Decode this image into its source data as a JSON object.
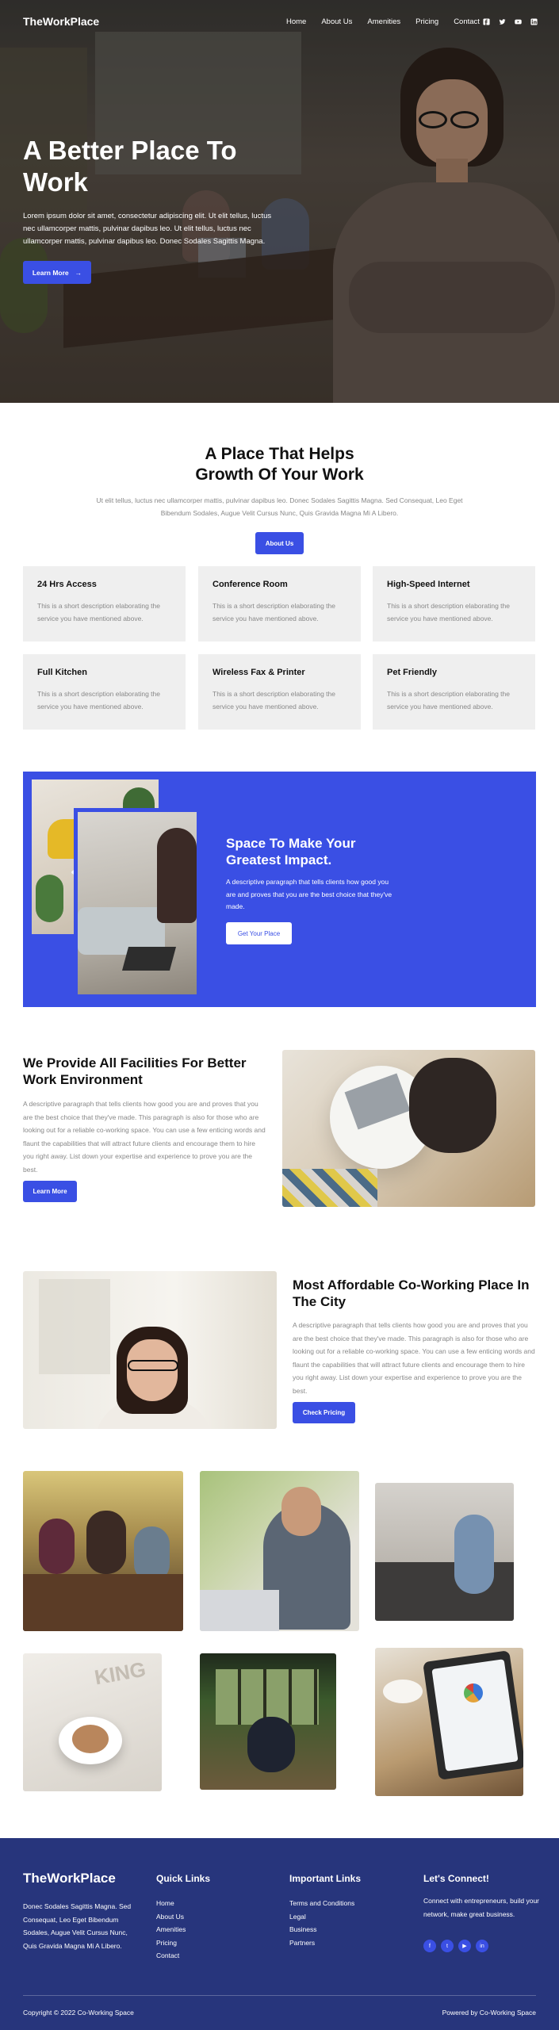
{
  "brand": {
    "logo": "TheWorkPlace",
    "accent": "#3a4fe4",
    "footer_bg": "#27357c"
  },
  "nav": {
    "items": [
      "Home",
      "About Us",
      "Amenities",
      "Pricing",
      "Contact"
    ],
    "socials": [
      "facebook-icon",
      "twitter-icon",
      "youtube-icon",
      "linkedin-icon"
    ]
  },
  "hero": {
    "title": "A Better Place To Work",
    "text": "Lorem ipsum dolor sit amet, consectetur adipiscing elit. Ut elit tellus, luctus nec ullamcorper mattis, pulvinar dapibus leo. Ut elit tellus, luctus nec ullamcorper mattis, pulvinar dapibus leo. Donec Sodales Sagittis Magna.",
    "button": "Learn More",
    "button_arrow": "→"
  },
  "intro": {
    "title": "A Place That Helps Growth Of Your Work",
    "text": "Ut elit tellus, luctus nec ullamcorper mattis, pulvinar dapibus leo. Donec Sodales Sagittis Magna. Sed Consequat, Leo Eget Bibendum Sodales, Augue Velit Cursus Nunc, Quis Gravida Magna Mi A Libero.",
    "button": "About Us"
  },
  "amenities": [
    {
      "title": "24 Hrs Access",
      "text": "This is a short description elaborating the service you have mentioned above."
    },
    {
      "title": "Conference Room",
      "text": "This is a short description elaborating the service you have mentioned above."
    },
    {
      "title": "High-Speed Internet",
      "text": "This is a short description elaborating the service you have mentioned above."
    },
    {
      "title": "Full Kitchen",
      "text": "This is a short description elaborating the service you have mentioned above."
    },
    {
      "title": "Wireless Fax & Printer",
      "text": "This is a short description elaborating the service you have mentioned above."
    },
    {
      "title": "Pet Friendly",
      "text": "This is a short description elaborating the service you have mentioned above."
    }
  ],
  "impact": {
    "title": "Space To Make Your Greatest Impact.",
    "text": "A descriptive paragraph that tells clients how good you are and proves that you are the best choice that they've made.",
    "button": "Get Your Place"
  },
  "facilities": {
    "title": "We Provide All Facilities For Better Work Environment",
    "text": "A descriptive paragraph that tells clients how good you are and proves that you are the best choice that they've made. This paragraph is also for those who are looking out for a reliable co-working space. You can use a few enticing words and flaunt the capabilities that will attract future clients and encourage them to hire you right away. List down your expertise and experience to prove you are the best.",
    "button": "Learn More"
  },
  "pricing": {
    "title": "Most Affordable Co-Working Place In The City",
    "text": "A descriptive paragraph that tells clients how good you are and proves that you are the best choice that they've made. This paragraph is also for those who are looking out for a reliable co-working space. You can use a few enticing words and flaunt the capabilities that will attract future clients and encourage them to hire you right away. List down your expertise and experience to prove you are the best.",
    "button": "Check Pricing"
  },
  "gallery_art": {
    "cup_text": "KING"
  },
  "footer": {
    "logo": "TheWorkPlace",
    "about": "Donec Sodales Sagittis Magna. Sed Consequat, Leo Eget Bibendum Sodales, Augue Velit Cursus Nunc, Quis Gravida Magna Mi A Libero.",
    "quick_links_title": "Quick Links",
    "quick_links": [
      "Home",
      "About Us",
      "Amenities",
      "Pricing",
      "Contact"
    ],
    "important_links_title": "Important Links",
    "important_links": [
      "Terms and Conditions",
      "Legal",
      "Business",
      "Partners"
    ],
    "connect_title": "Let's Connect!",
    "connect_text": "Connect with entrepreneurs, build your network, make great business.",
    "socials": [
      "facebook-icon",
      "twitter-icon",
      "youtube-icon",
      "linkedin-icon"
    ],
    "copyright": "Copyright © 2022 Co-Working Space",
    "powered": "Powered by Co-Working Space"
  }
}
